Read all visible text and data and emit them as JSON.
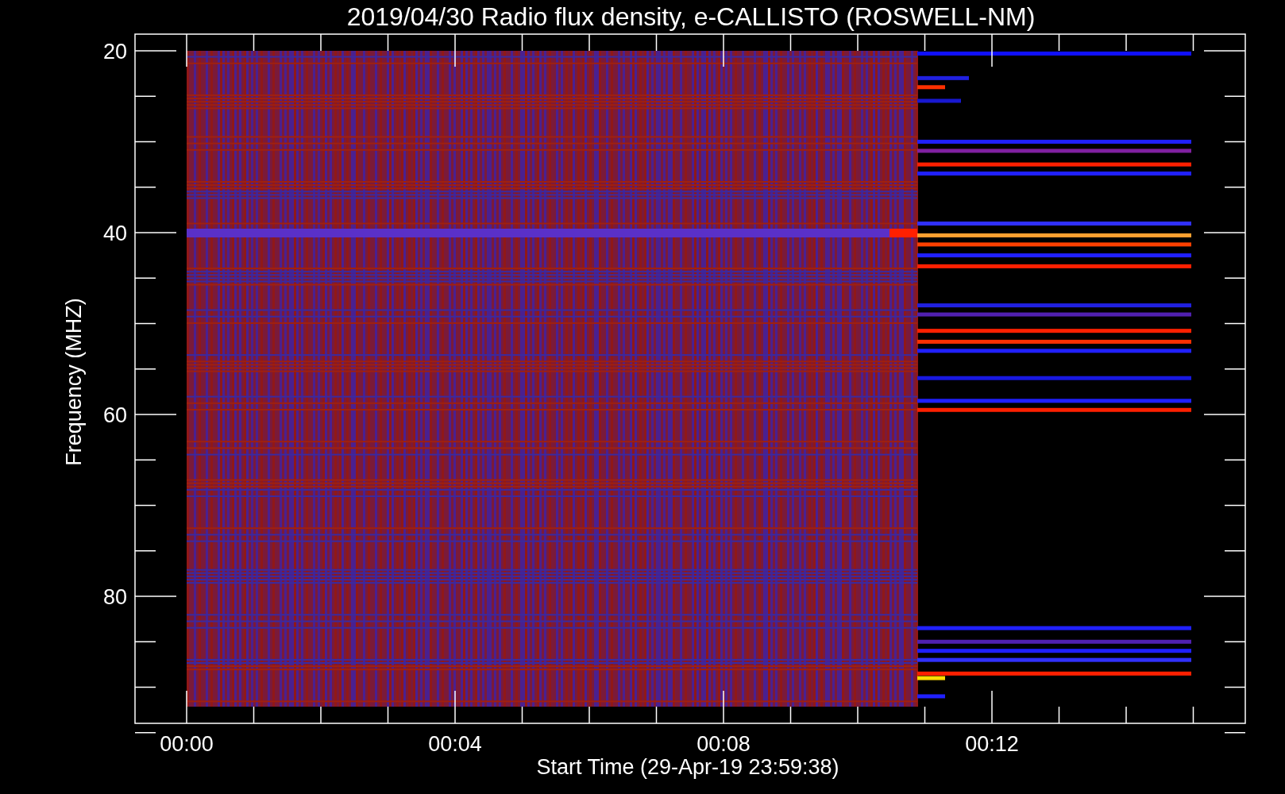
{
  "title": "2019/04/30  Radio flux density, e-CALLISTO (ROSWELL-NM)",
  "plot": {
    "ylabel": "Frequency (MHZ)",
    "xlabel": "Start Time (29-Apr-19 23:59:38)",
    "y_ticks": [
      "20",
      "40",
      "60",
      "80"
    ],
    "x_ticks": [
      "00:00",
      "00:04",
      "00:08",
      "00:12"
    ]
  }
}
